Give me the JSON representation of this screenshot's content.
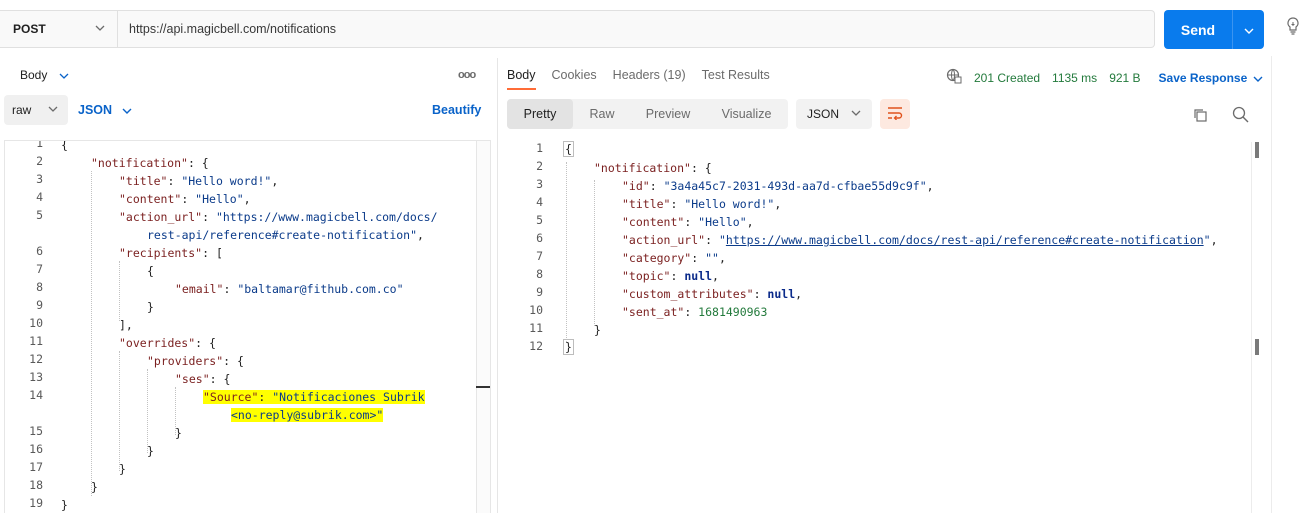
{
  "request": {
    "method": "POST",
    "url": "https://api.magicbell.com/notifications",
    "send_label": "Send"
  },
  "body_panel": {
    "tab_label": "Body",
    "mode": "raw",
    "language": "JSON",
    "beautify_label": "Beautify"
  },
  "response_panel": {
    "tabs": [
      "Body",
      "Cookies",
      "Headers (19)",
      "Test Results"
    ],
    "status": "201 Created",
    "time": "1135 ms",
    "size": "921 B",
    "save_label": "Save Response",
    "view_tabs": [
      "Pretty",
      "Raw",
      "Preview",
      "Visualize"
    ],
    "format": "JSON"
  },
  "request_body_code": {
    "line_numbers": [
      "1",
      "2",
      "3",
      "4",
      "5",
      "",
      "6",
      "7",
      "8",
      "9",
      "10",
      "11",
      "12",
      "13",
      "14",
      "",
      "15",
      "16",
      "17",
      "18",
      "19"
    ],
    "brace_open": "{",
    "notification_key": "\"notification\"",
    "title_key": "\"title\"",
    "title_val": "\"Hello word!\"",
    "content_key": "\"content\"",
    "content_val": "\"Hello\"",
    "action_key": "\"action_url\"",
    "action_val_a": "\"https://www.magicbell.com/docs/",
    "action_val_b": "rest-api/reference#create-notification\"",
    "recipients_key": "\"recipients\"",
    "email_key": "\"email\"",
    "email_val": "\"baltamar@fithub.com.co\"",
    "overrides_key": "\"overrides\"",
    "providers_key": "\"providers\"",
    "ses_key": "\"ses\"",
    "source_key": "\"Source\"",
    "source_val_a": "\"Notificaciones Subrik",
    "source_val_b": "<no-reply@subrik.com>\""
  },
  "response_body_code": {
    "line_numbers": [
      "1",
      "2",
      "3",
      "4",
      "5",
      "6",
      "7",
      "8",
      "9",
      "10",
      "11",
      "12"
    ],
    "notification_key": "\"notification\"",
    "id_key": "\"id\"",
    "id_val": "\"3a4a45c7-2031-493d-aa7d-cfbae55d9c9f\"",
    "title_key": "\"title\"",
    "title_val": "\"Hello word!\"",
    "content_key": "\"content\"",
    "content_val": "\"Hello\"",
    "action_key": "\"action_url\"",
    "action_val": "https://www.magicbell.com/docs/rest-api/reference#create-notification",
    "category_key": "\"category\"",
    "category_val": "\"\"",
    "topic_key": "\"topic\"",
    "custom_key": "\"custom_attributes\"",
    "sent_key": "\"sent_at\"",
    "sent_val": "1681490963",
    "null_val": "null"
  },
  "colors": {
    "accent_blue": "#097bed",
    "status_green": "#237a3c",
    "tab_underline": "#ff6c37",
    "highlight": "#ffff00"
  }
}
